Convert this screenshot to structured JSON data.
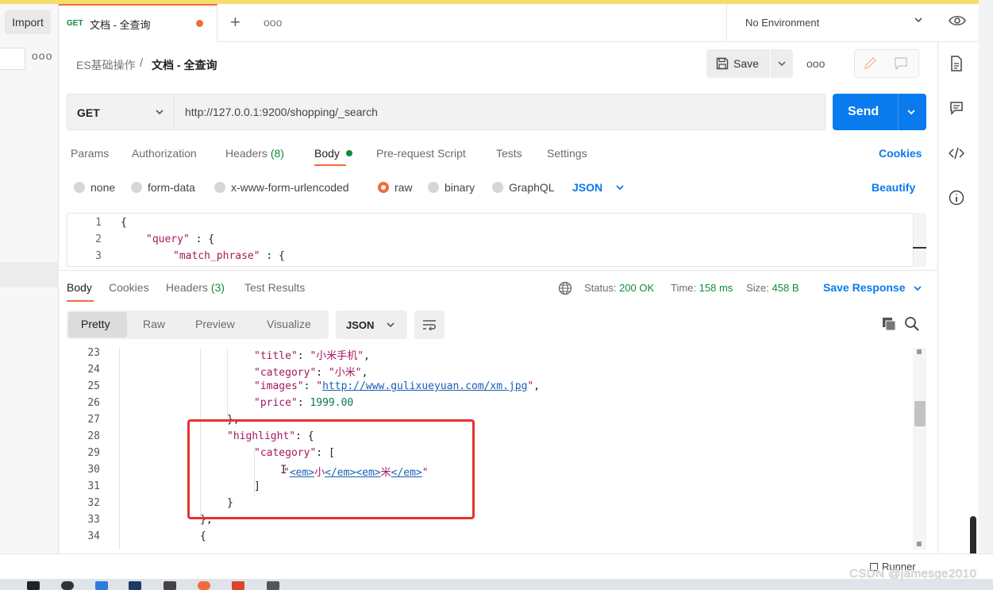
{
  "sidebar": {
    "import_label": "Import",
    "more": "ooo"
  },
  "tabs": {
    "active": {
      "method": "GET",
      "title": "文档 - 全查询"
    },
    "plus": "+",
    "more": "ooo"
  },
  "environment": {
    "label": "No Environment"
  },
  "breadcrumb": {
    "parent": "ES基础操作",
    "separator": "/",
    "current": "文档 - 全查询"
  },
  "toolbar": {
    "save_label": "Save",
    "more": "ooo"
  },
  "request": {
    "method": "GET",
    "url": "http://127.0.0.1:9200/shopping/_search",
    "send_label": "Send"
  },
  "request_tabs": [
    {
      "label": "Params"
    },
    {
      "label": "Authorization"
    },
    {
      "label": "Headers ",
      "count": "(8)"
    },
    {
      "label": "Body"
    },
    {
      "label": "Pre-request Script"
    },
    {
      "label": "Tests"
    },
    {
      "label": "Settings"
    }
  ],
  "cookies_label": "Cookies",
  "body_types": [
    "none",
    "form-data",
    "x-www-form-urlencoded",
    "raw",
    "binary",
    "GraphQL"
  ],
  "body_format": "JSON",
  "beautify_label": "Beautify",
  "request_body": [
    {
      "n": "1",
      "text": "{"
    },
    {
      "n": "2",
      "key": "\"query\"",
      "rest": " : {"
    },
    {
      "n": "3",
      "key": "\"match_phrase\"",
      "rest": " : {"
    }
  ],
  "response_tabs": [
    {
      "label": "Body"
    },
    {
      "label": "Cookies"
    },
    {
      "label": "Headers ",
      "count": "(3)"
    },
    {
      "label": "Test Results"
    }
  ],
  "response_status": {
    "status_label": "Status:",
    "status_value": "200 OK",
    "time_label": "Time:",
    "time_value": "158 ms",
    "size_label": "Size:",
    "size_value": "458 B",
    "save_response": "Save Response"
  },
  "view_modes": [
    "Pretty",
    "Raw",
    "Preview",
    "Visualize"
  ],
  "response_format": "JSON",
  "response_body": [
    {
      "n": "23",
      "key": "\"title\"",
      "sep": ": ",
      "val": "\"小米手机\"",
      "tail": ","
    },
    {
      "n": "24",
      "key": "\"category\"",
      "sep": ": ",
      "val": "\"小米\"",
      "tail": ","
    },
    {
      "n": "25",
      "key": "\"images\"",
      "sep": ": ",
      "q1": "\"",
      "url": "http://www.gulixueyuan.com/xm.jpg",
      "q2": "\"",
      "tail": ","
    },
    {
      "n": "26",
      "key": "\"price\"",
      "sep": ": ",
      "num": "1999.00"
    },
    {
      "n": "27",
      "text": "},"
    },
    {
      "n": "28",
      "key": "\"highlight\"",
      "sep": ": ",
      "tail": "{"
    },
    {
      "n": "29",
      "key": "\"category\"",
      "sep": ": ",
      "tail": "["
    },
    {
      "n": "30",
      "hl": [
        "\"",
        "<em>",
        "小",
        "</em>",
        "<em>",
        "米",
        "</em>",
        "\""
      ]
    },
    {
      "n": "31",
      "text": "]"
    },
    {
      "n": "32",
      "text": "}"
    },
    {
      "n": "33",
      "text": "},"
    },
    {
      "n": "34",
      "text": "{"
    }
  ],
  "footer": {
    "runner_label": "Runner",
    "watermark": "CSDN @jamesge2010"
  },
  "colors": {
    "accent": "#f26b3a",
    "primary": "#097bed",
    "success": "#0f8a3a",
    "highlight_box": "#e8312f"
  }
}
